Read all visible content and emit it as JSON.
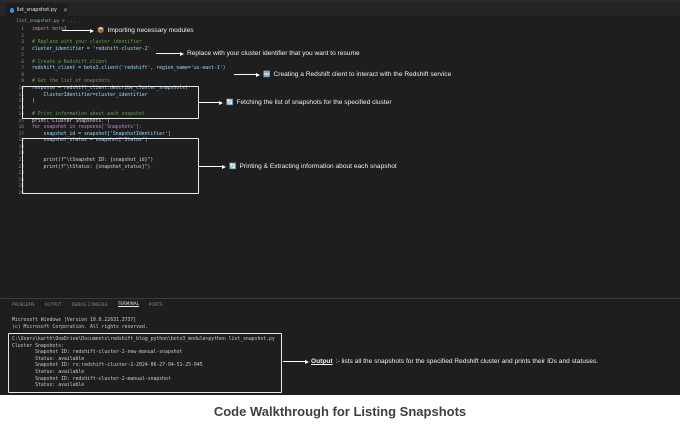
{
  "tab": {
    "filename": "list_snapshot.py",
    "close_glyph": "✕"
  },
  "breadcrumb": "list_snapshot.py > ...",
  "gutter": [
    "1",
    "2",
    "3",
    "4",
    "5",
    "6",
    "7",
    "8",
    "9",
    "10",
    "11",
    "12",
    "13",
    "14",
    "15",
    "16",
    "17",
    "18",
    "19",
    "20",
    "21",
    "22",
    "23",
    "24",
    "25",
    "26"
  ],
  "code_lines": [
    "import boto3",
    "",
    "# Replace with your cluster identifier",
    "cluster_identifier = 'redshift-cluster-2'",
    "",
    "# Create a Redshift client",
    "redshift_client = boto3.client('redshift', region_name='us-east-1')",
    "",
    "# Get the list of snapshots",
    "response = redshift_client.describe_cluster_snapshots(",
    "    ClusterIdentifier=cluster_identifier",
    ")",
    "",
    "# Print information about each snapshot",
    "print(\"Cluster Snapshots:\")",
    "for snapshot in response['Snapshots']:",
    "    snapshot_id = snapshot['SnapshotIdentifier']",
    "    snapshot_status = snapshot['Status']",
    "",
    "",
    "    print(f\"\\tSnapshot ID: {snapshot_id}\")",
    "    print(f\"\\tStatus: {snapshot_status}\")",
    "",
    "",
    "",
    ""
  ],
  "annotations": {
    "import": {
      "emoji": "📦",
      "text": "Importing necessary modules"
    },
    "replace": {
      "text": "Replace with your cluster identifier that you want to resume"
    },
    "client": {
      "emoji": "🆕",
      "text": "Creating a Redshift client to interact with the Redshift service"
    },
    "fetch": {
      "emoji": "🔄",
      "text": "Fetching the list of snapshots for the specified cluster"
    },
    "print": {
      "emoji": "🔄",
      "text": "Printing & Extracting information about each snapshot"
    }
  },
  "panel_tabs": [
    "PROBLEMS",
    "OUTPUT",
    "DEBUG CONSOLE",
    "TERMINAL",
    "PORTS"
  ],
  "panel_active_tab": "TERMINAL",
  "terminal": {
    "header": [
      "Microsoft Windows [Version 10.0.22631.3737]",
      "(c) Microsoft Corporation. All rights reserved."
    ],
    "output": [
      "C:\\Users\\karth\\OneDrive\\Documents\\redshift_blog_python\\boto3_module>python list_snapshot.py",
      "Cluster Snapshots:",
      "        Snapshot ID: redshift-cluster-2-new-manual-snapshot",
      "        Status: available",
      "        Snapshot ID: rs:redshift-cluster-2-2024-06-27-04-51-25-045",
      "        Status: available",
      "        Snapshot ID: redshift-cluster-2-manual-snapshot",
      "        Status: available"
    ]
  },
  "output_annotation": {
    "label": "Output",
    "text": ":- lists all the snapshots for the specified Redshift cluster and prints their IDs and statuses."
  },
  "caption": "Code Walkthrough for Listing Snapshots",
  "colors": {
    "editor_bg": "#1e1e1e",
    "comment": "#6a9955",
    "keyword": "#c586c0",
    "caption": "#3f3f3f"
  }
}
